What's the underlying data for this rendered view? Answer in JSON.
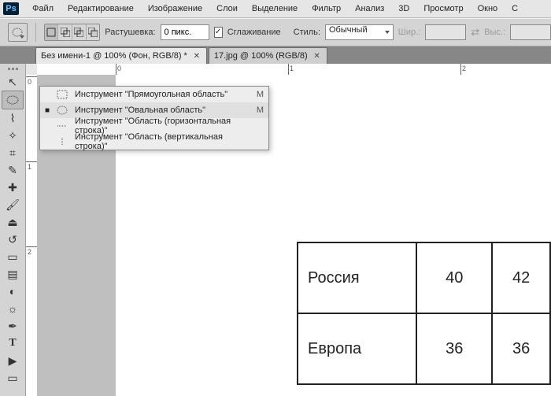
{
  "logo": "Ps",
  "menu": [
    "Файл",
    "Редактирование",
    "Изображение",
    "Слои",
    "Выделение",
    "Фильтр",
    "Анализ",
    "3D",
    "Просмотр",
    "Окно",
    "С"
  ],
  "options": {
    "feather_label": "Растушевка:",
    "feather_value": "0 пикс.",
    "antialias_label": "Сглаживание",
    "antialias_checked": "✓",
    "style_label": "Стиль:",
    "style_value": "Обычный",
    "width_label": "Шир.:",
    "height_label": "Выс.:"
  },
  "tabs": [
    {
      "label": "Без имени-1 @ 100% (Фон, RGB/8) *",
      "active": true
    },
    {
      "label": "17.jpg @ 100% (RGB/8)",
      "active": false
    }
  ],
  "flyout": {
    "items": [
      {
        "label": "Инструмент \"Прямоугольная область\"",
        "shortcut": "M",
        "active": false
      },
      {
        "label": "Инструмент \"Овальная область\"",
        "shortcut": "M",
        "active": true
      },
      {
        "label": "Инструмент \"Область (горизонтальная строка)\"",
        "shortcut": "",
        "active": false
      },
      {
        "label": "Инструмент \"Область (вертикальная строка)\"",
        "shortcut": "",
        "active": false
      }
    ]
  },
  "ruler_h": [
    "0",
    "1",
    "2"
  ],
  "ruler_v": [
    "0",
    "1",
    "2"
  ],
  "doc_table": {
    "rows": [
      {
        "label": "Россия",
        "c1": "40",
        "c2": "42"
      },
      {
        "label": "Европа",
        "c1": "36",
        "c2": "36"
      }
    ]
  },
  "tool_names": [
    "move",
    "marquee-ellipse",
    "lasso",
    "magic-wand",
    "crop",
    "eyedropper",
    "healing",
    "brush",
    "stamp",
    "history-brush",
    "eraser",
    "gradient",
    "blur",
    "dodge",
    "pen",
    "type",
    "path-select",
    "rectangle"
  ]
}
